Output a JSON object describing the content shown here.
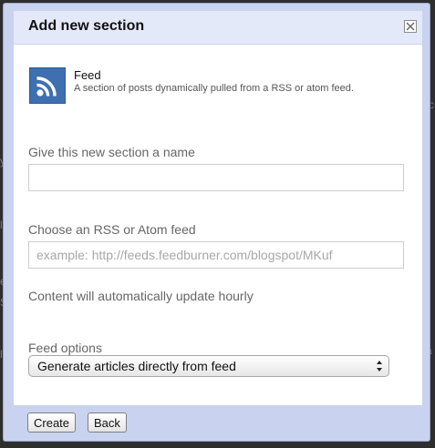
{
  "dialog": {
    "title": "Add new section",
    "close_icon": "close-x-icon"
  },
  "feed": {
    "icon": "rss-feed-icon",
    "title": "Feed",
    "description": "A section of posts dynamically pulled from a RSS or atom feed."
  },
  "form": {
    "name_label": "Give this new section a name",
    "name_value": "",
    "feed_label": "Choose an RSS or Atom feed",
    "feed_placeholder": "example: http://feeds.feedburner.com/blogspot/MKuf",
    "update_note": "Content will automatically update hourly",
    "options_label": "Feed options",
    "options_selected": "Generate articles directly from feed"
  },
  "footer": {
    "create_label": "Create",
    "back_label": "Back"
  },
  "colors": {
    "dialog_frame": "#c9d3f0",
    "titlebar": "#e4e9fa",
    "rss_blue": "#3e6fb0"
  }
}
